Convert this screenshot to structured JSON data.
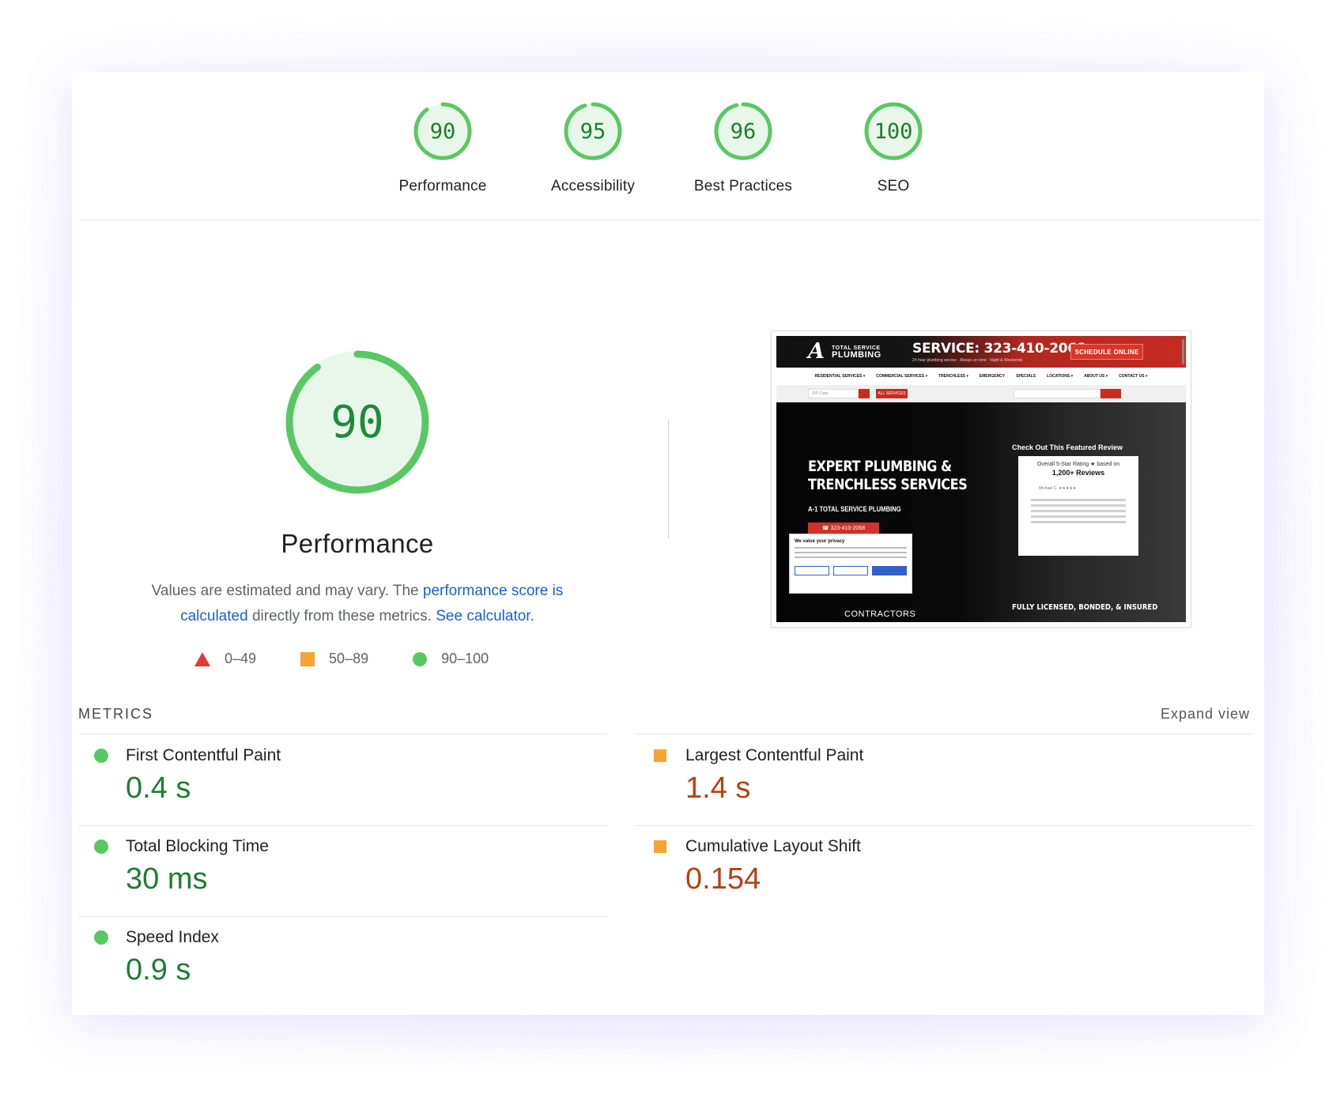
{
  "categories": [
    {
      "score": "90",
      "label": "Performance"
    },
    {
      "score": "95",
      "label": "Accessibility"
    },
    {
      "score": "96",
      "label": "Best Practices"
    },
    {
      "score": "100",
      "label": "SEO"
    }
  ],
  "main": {
    "score": "90",
    "title": "Performance",
    "desc_part1": "Values are estimated and may vary. The ",
    "desc_link1": "performance score is calculated",
    "desc_part2": " directly from these metrics. ",
    "desc_link2": "See calculator."
  },
  "legend": {
    "poor": "0–49",
    "average": "50–89",
    "good": "90–100"
  },
  "thumbnail": {
    "logo_mark": "A",
    "logo_line1": "TOTAL SERVICE",
    "logo_line2": "PLUMBING",
    "phone": "SERVICE: 323-410-2068",
    "phone_sub": "24 hour plumbing service · Always on time · Night & Weekends",
    "schedule": "SCHEDULE ONLINE",
    "nav": [
      "RESIDENTIAL SERVICES ▾",
      "COMMERCIAL SERVICES ▾",
      "TRENCHLESS ▾",
      "EMERGENCY",
      "SPECIALS",
      "LOCATIONS ▾",
      "ABOUT US ▾",
      "CONTACT US ▾"
    ],
    "zip": "ZIP Code",
    "all_services": "ALL SERVICES",
    "hero_title_1": "EXPERT PLUMBING &",
    "hero_title_2": "TRENCHLESS SERVICES",
    "hero_sub": "A-1 TOTAL SERVICE PLUMBING",
    "hero_call": "☎ 323-410-2068",
    "review_head": "Check Out This Featured Review",
    "review_rating": "Overall 5-Star Rating ★ based on",
    "review_count": "1,200+ Reviews",
    "reviewer": "Michael C. ★★★★★",
    "cookie_title": "We value your privacy",
    "contractors": "CONTRACTORS",
    "licensed": "FULLY LICENSED, BONDED, & INSURED"
  },
  "metrics": {
    "section_label": "METRICS",
    "expand_label": "Expand view",
    "left": [
      {
        "name": "First Contentful Paint",
        "value": "0.4 s",
        "status": "good"
      },
      {
        "name": "Total Blocking Time",
        "value": "30 ms",
        "status": "good"
      },
      {
        "name": "Speed Index",
        "value": "0.9 s",
        "status": "good"
      }
    ],
    "right": [
      {
        "name": "Largest Contentful Paint",
        "value": "1.4 s",
        "status": "average"
      },
      {
        "name": "Cumulative Layout Shift",
        "value": "0.154",
        "status": "average"
      }
    ]
  },
  "colors": {
    "good": "#5ac862",
    "good_text": "#1e7d32",
    "average": "#f4a535",
    "average_text": "#b9410f",
    "poor": "#e53935",
    "link": "#1a5fd0"
  }
}
